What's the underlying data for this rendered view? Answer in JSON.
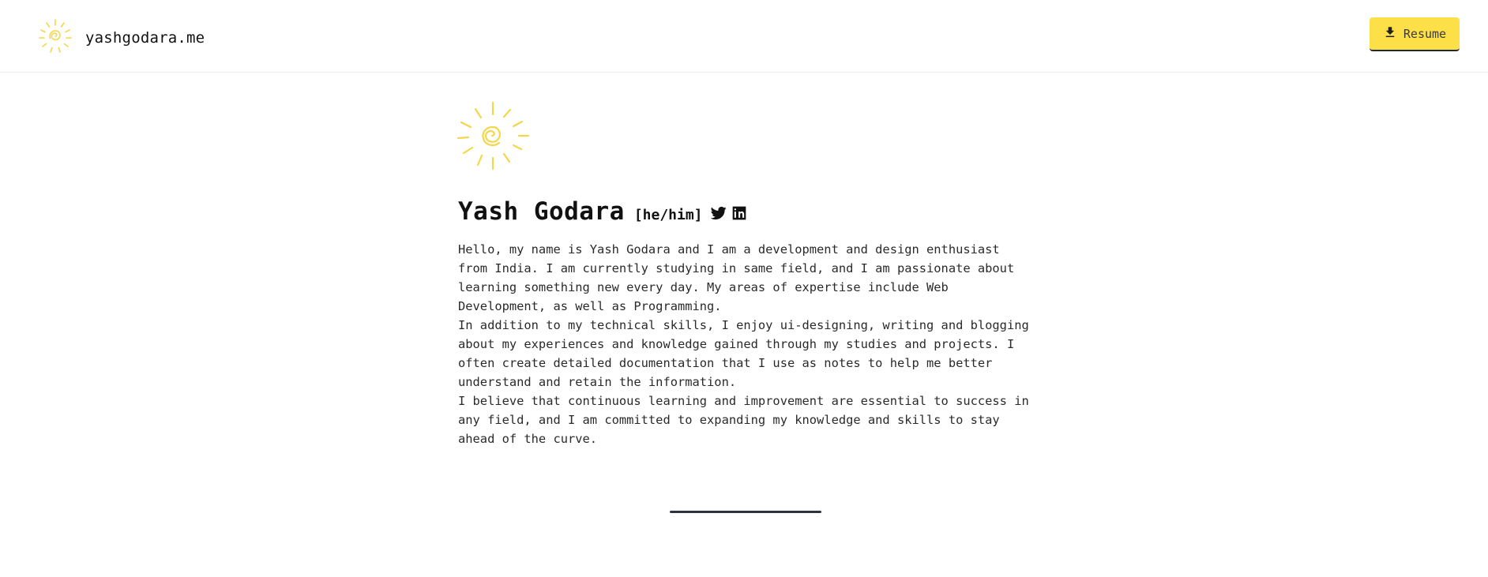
{
  "header": {
    "brand_text": "yashgodara.me",
    "logo_icon": "sun-spiral-icon",
    "resume_label": "Resume",
    "resume_icon": "download-icon"
  },
  "profile": {
    "name": "Yash Godara",
    "pronouns": "[he/him]",
    "social_icons": [
      "twitter-icon",
      "linkedin-icon"
    ]
  },
  "bio": {
    "paragraphs": [
      "Hello, my name is Yash Godara and I am a development and design enthusiast from India. I am currently studying in same field, and I am passionate about learning something new every day. My areas of expertise include Web Development, as well as Programming.",
      "In addition to my technical skills, I enjoy ui-designing, writing and blogging about my experiences and knowledge gained through my studies and projects. I often create detailed documentation that I use as notes to help me better understand and retain the information.",
      "I believe that continuous learning and improvement are essential to success in any field, and I am committed to expanding my knowledge and skills to stay ahead of the curve."
    ]
  },
  "colors": {
    "accent": "#fde047",
    "sun": "#f5d64a",
    "divider": "#2d3340"
  }
}
